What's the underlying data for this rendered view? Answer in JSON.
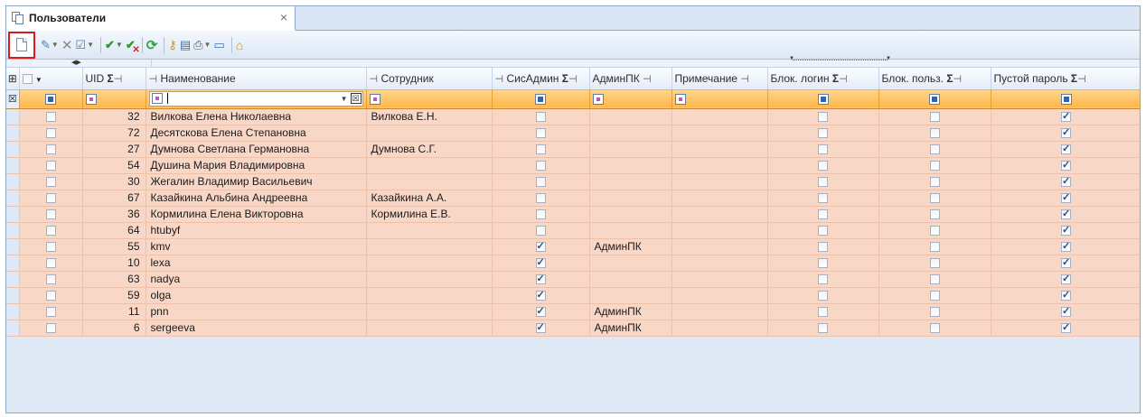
{
  "tab": {
    "title": "Пользователи",
    "close": "×"
  },
  "toolbar": {
    "icons": [
      "new-document-icon",
      "edit-icon",
      "delete-icon",
      "approve-icon",
      "check-icon",
      "uncheck-icon",
      "refresh-icon",
      "key-icon",
      "list-icon",
      "print-icon",
      "screen-icon",
      "bank-icon"
    ],
    "highlight": "#e0191d"
  },
  "grid": {
    "headers": {
      "uid": "UID",
      "name": "Наименование",
      "employee": "Сотрудник",
      "sysadmin": "СисАдмин",
      "adminpk": "АдминПК",
      "note": "Примечание",
      "block_login": "Блок. логин",
      "block_user": "Блок. польз.",
      "empty_password": "Пустой пароль"
    },
    "rows": [
      {
        "uid": "32",
        "name": "Вилкова Елена Николаевна",
        "employee": "Вилкова Е.Н.",
        "sysadmin": false,
        "adminpk": "",
        "note": "",
        "block_login": false,
        "block_user": false,
        "empty_password": true
      },
      {
        "uid": "72",
        "name": "Десятскова Елена Степановна",
        "employee": "",
        "sysadmin": false,
        "adminpk": "",
        "note": "",
        "block_login": false,
        "block_user": false,
        "empty_password": true
      },
      {
        "uid": "27",
        "name": "Думнова Светлана Германовна",
        "employee": "Думнова С.Г.",
        "sysadmin": false,
        "adminpk": "",
        "note": "",
        "block_login": false,
        "block_user": false,
        "empty_password": true
      },
      {
        "uid": "54",
        "name": "Душина Мария Владимировна",
        "employee": "",
        "sysadmin": false,
        "adminpk": "",
        "note": "",
        "block_login": false,
        "block_user": false,
        "empty_password": true
      },
      {
        "uid": "30",
        "name": "Жегалин Владимир Васильевич",
        "employee": "",
        "sysadmin": false,
        "adminpk": "",
        "note": "",
        "block_login": false,
        "block_user": false,
        "empty_password": true
      },
      {
        "uid": "67",
        "name": "Казайкина Альбина Андреевна",
        "employee": "Казайкина А.А.",
        "sysadmin": false,
        "adminpk": "",
        "note": "",
        "block_login": false,
        "block_user": false,
        "empty_password": true
      },
      {
        "uid": "36",
        "name": "Кормилина Елена Викторовна",
        "employee": "Кормилина Е.В.",
        "sysadmin": false,
        "adminpk": "",
        "note": "",
        "block_login": false,
        "block_user": false,
        "empty_password": true
      },
      {
        "uid": "64",
        "name": "htubyf",
        "employee": "",
        "sysadmin": false,
        "adminpk": "",
        "note": "",
        "block_login": false,
        "block_user": false,
        "empty_password": true
      },
      {
        "uid": "55",
        "name": "kmv",
        "employee": "",
        "sysadmin": true,
        "adminpk": "АдминПК",
        "note": "",
        "block_login": false,
        "block_user": false,
        "empty_password": true
      },
      {
        "uid": "10",
        "name": "lexa",
        "employee": "",
        "sysadmin": true,
        "adminpk": "",
        "note": "",
        "block_login": false,
        "block_user": false,
        "empty_password": true
      },
      {
        "uid": "63",
        "name": "nadya",
        "employee": "",
        "sysadmin": true,
        "adminpk": "",
        "note": "",
        "block_login": false,
        "block_user": false,
        "empty_password": true
      },
      {
        "uid": "59",
        "name": "olga",
        "employee": "",
        "sysadmin": true,
        "adminpk": "",
        "note": "",
        "block_login": false,
        "block_user": false,
        "empty_password": true
      },
      {
        "uid": "11",
        "name": "pnn",
        "employee": "",
        "sysadmin": true,
        "adminpk": "АдминПК",
        "note": "",
        "block_login": false,
        "block_user": false,
        "empty_password": true
      },
      {
        "uid": "6",
        "name": "sergeeva",
        "employee": "",
        "sysadmin": true,
        "adminpk": "АдминПК",
        "note": "",
        "block_login": false,
        "block_user": false,
        "empty_password": true
      }
    ]
  }
}
